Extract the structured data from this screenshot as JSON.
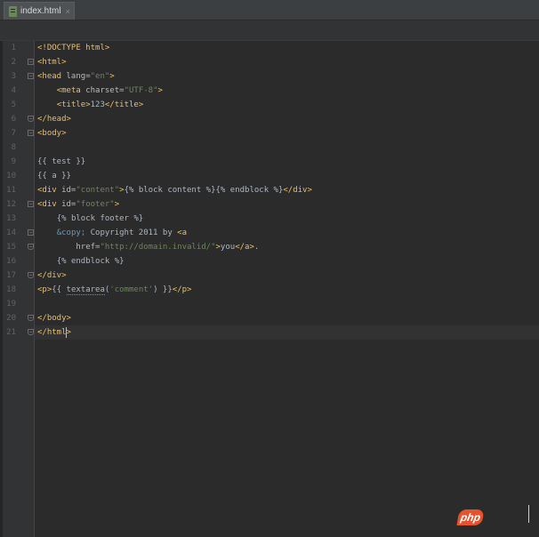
{
  "editor": {
    "tabs": [
      {
        "label": "index.html",
        "close": "×",
        "icon": "html-file-icon"
      }
    ],
    "caret_line": 21
  },
  "code_lines": [
    {
      "n": "1",
      "tokens": [
        {
          "c": "t",
          "s": "<!DOCTYPE html>"
        }
      ]
    },
    {
      "n": "2",
      "tokens": [
        {
          "c": "t",
          "s": "<html>"
        }
      ]
    },
    {
      "n": "3",
      "tokens": [
        {
          "c": "t",
          "s": "<head "
        },
        {
          "c": "a",
          "s": "lang="
        },
        {
          "c": "v",
          "s": "\"en\""
        },
        {
          "c": "t",
          "s": ">"
        }
      ]
    },
    {
      "n": "4",
      "tokens": [
        {
          "c": "tx",
          "s": "    "
        },
        {
          "c": "t",
          "s": "<meta "
        },
        {
          "c": "a",
          "s": "charset="
        },
        {
          "c": "v",
          "s": "\"UTF-8\""
        },
        {
          "c": "t",
          "s": ">"
        }
      ]
    },
    {
      "n": "5",
      "tokens": [
        {
          "c": "tx",
          "s": "    "
        },
        {
          "c": "t",
          "s": "<title>"
        },
        {
          "c": "tx",
          "s": "123"
        },
        {
          "c": "t",
          "s": "</title>"
        }
      ]
    },
    {
      "n": "6",
      "tokens": [
        {
          "c": "t",
          "s": "</head>"
        }
      ]
    },
    {
      "n": "7",
      "tokens": [
        {
          "c": "t",
          "s": "<body>"
        }
      ]
    },
    {
      "n": "8",
      "tokens": []
    },
    {
      "n": "9",
      "tokens": [
        {
          "c": "tpl",
          "s": "{{ test }}"
        }
      ]
    },
    {
      "n": "10",
      "tokens": [
        {
          "c": "tpl",
          "s": "{{ a }}"
        }
      ]
    },
    {
      "n": "11",
      "tokens": [
        {
          "c": "t",
          "s": "<div "
        },
        {
          "c": "a",
          "s": "id="
        },
        {
          "c": "v",
          "s": "\"content\""
        },
        {
          "c": "t",
          "s": ">"
        },
        {
          "c": "tpl",
          "s": "{% block content %}{% endblock %}"
        },
        {
          "c": "t",
          "s": "</div>"
        }
      ]
    },
    {
      "n": "12",
      "tokens": [
        {
          "c": "t",
          "s": "<div "
        },
        {
          "c": "a",
          "s": "id="
        },
        {
          "c": "v",
          "s": "\"footer\""
        },
        {
          "c": "t",
          "s": ">"
        }
      ]
    },
    {
      "n": "13",
      "tokens": [
        {
          "c": "tx",
          "s": "    "
        },
        {
          "c": "tpl",
          "s": "{% block footer %}"
        }
      ]
    },
    {
      "n": "14",
      "tokens": [
        {
          "c": "tx",
          "s": "    "
        },
        {
          "c": "ent",
          "s": "&copy;"
        },
        {
          "c": "tx",
          "s": " Copyright 2011 by "
        },
        {
          "c": "t",
          "s": "<a"
        }
      ]
    },
    {
      "n": "15",
      "tokens": [
        {
          "c": "tx",
          "s": "        "
        },
        {
          "c": "a",
          "s": "href="
        },
        {
          "c": "v",
          "s": "\"http://domain.invalid/\""
        },
        {
          "c": "t",
          "s": ">"
        },
        {
          "c": "tx",
          "s": "you"
        },
        {
          "c": "t",
          "s": "</a>"
        },
        {
          "c": "tx",
          "s": "."
        }
      ]
    },
    {
      "n": "16",
      "tokens": [
        {
          "c": "tx",
          "s": "    "
        },
        {
          "c": "tpl",
          "s": "{% endblock %}"
        }
      ]
    },
    {
      "n": "17",
      "tokens": [
        {
          "c": "t",
          "s": "</div>"
        }
      ]
    },
    {
      "n": "18",
      "tokens": [
        {
          "c": "t",
          "s": "<p>"
        },
        {
          "c": "tpl",
          "s": "{{ "
        },
        {
          "c": "tpl squiggle",
          "s": "textarea"
        },
        {
          "c": "tpl",
          "s": "("
        },
        {
          "c": "v",
          "s": "'comment'"
        },
        {
          "c": "tpl",
          "s": ") }}"
        },
        {
          "c": "t",
          "s": "</p>"
        }
      ]
    },
    {
      "n": "19",
      "tokens": []
    },
    {
      "n": "20",
      "tokens": [
        {
          "c": "t",
          "s": "</body>"
        }
      ]
    },
    {
      "n": "21",
      "tokens": [
        {
          "c": "t",
          "s": "</html>"
        }
      ]
    }
  ],
  "folds": [
    {
      "line": 2,
      "kind": "start",
      "glyph": "−"
    },
    {
      "line": 3,
      "kind": "start",
      "glyph": "−"
    },
    {
      "line": 6,
      "kind": "end",
      "glyph": "−"
    },
    {
      "line": 7,
      "kind": "start",
      "glyph": "−"
    },
    {
      "line": 12,
      "kind": "start",
      "glyph": "−"
    },
    {
      "line": 14,
      "kind": "start",
      "glyph": "−"
    },
    {
      "line": 15,
      "kind": "end",
      "glyph": "−"
    },
    {
      "line": 17,
      "kind": "end",
      "glyph": "−"
    },
    {
      "line": 20,
      "kind": "end",
      "glyph": "−"
    },
    {
      "line": 21,
      "kind": "end",
      "glyph": "−"
    }
  ],
  "watermark": {
    "text": "php"
  }
}
